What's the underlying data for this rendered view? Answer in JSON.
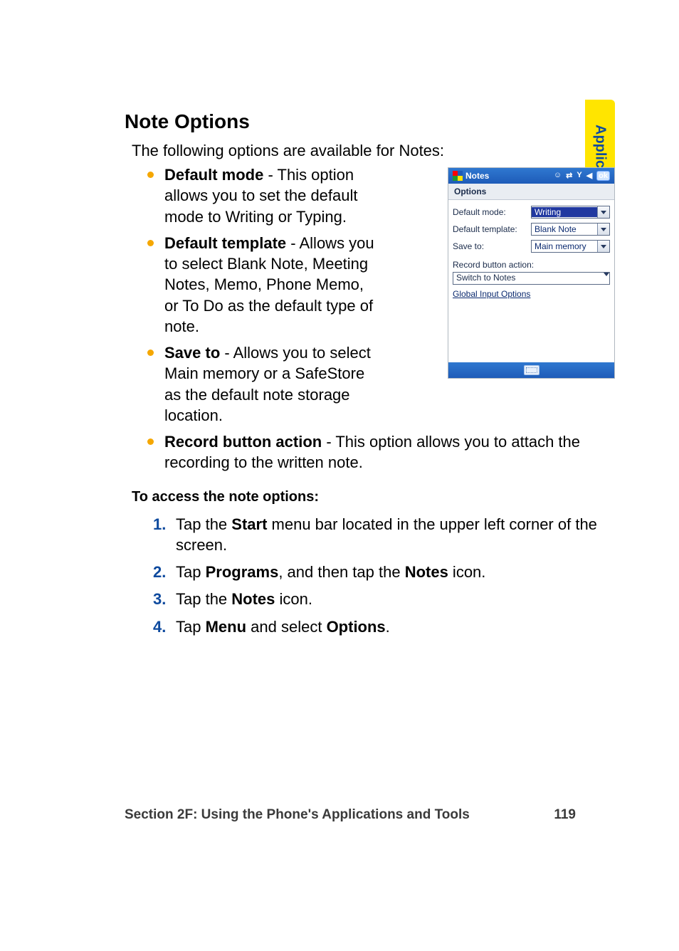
{
  "side_tab": "Applications & Tools",
  "heading": "Note Options",
  "intro": "The following options are available for Notes:",
  "bullets": [
    {
      "term": "Default mode",
      "rest": " - This option allows you to set the default mode to Writing or Typing."
    },
    {
      "term": "Default template",
      "rest": " - Allows you to select Blank Note, Meeting Notes, Memo, Phone Memo, or To Do as the default type of note."
    },
    {
      "term": "Save to",
      "rest": " - Allows you to select Main memory or a SafeStore as the default note storage location."
    },
    {
      "term": "Record button action",
      "rest": " - This option allows you to attach the recording to the written note."
    }
  ],
  "task_label": "To access the note options:",
  "steps": [
    {
      "pre": "Tap the ",
      "bolds": [
        {
          "t": "Start"
        }
      ],
      "tail": " menu bar located in the upper left corner of the screen."
    },
    {
      "pre": "Tap ",
      "bolds": [
        {
          "t": "Programs"
        },
        {
          "mid": ", and then tap the "
        },
        {
          "t": "Notes"
        }
      ],
      "tail": " icon."
    },
    {
      "pre": "Tap the ",
      "bolds": [
        {
          "t": "Notes"
        }
      ],
      "tail": " icon."
    },
    {
      "pre": "Tap ",
      "bolds": [
        {
          "t": "Menu"
        },
        {
          "mid": " and select "
        },
        {
          "t": "Options"
        }
      ],
      "tail": "."
    }
  ],
  "screenshot": {
    "title": "Notes",
    "ok": "ok",
    "menu": "Options",
    "fields": {
      "mode_label": "Default mode:",
      "mode_value": "Writing",
      "template_label": "Default template:",
      "template_value": "Blank Note",
      "saveto_label": "Save to:",
      "saveto_value": "Main memory",
      "record_label": "Record button action:",
      "record_value": "Switch to Notes",
      "link": "Global Input Options"
    }
  },
  "footer": {
    "section": "Section 2F: Using the Phone's Applications and Tools",
    "page": "119"
  }
}
